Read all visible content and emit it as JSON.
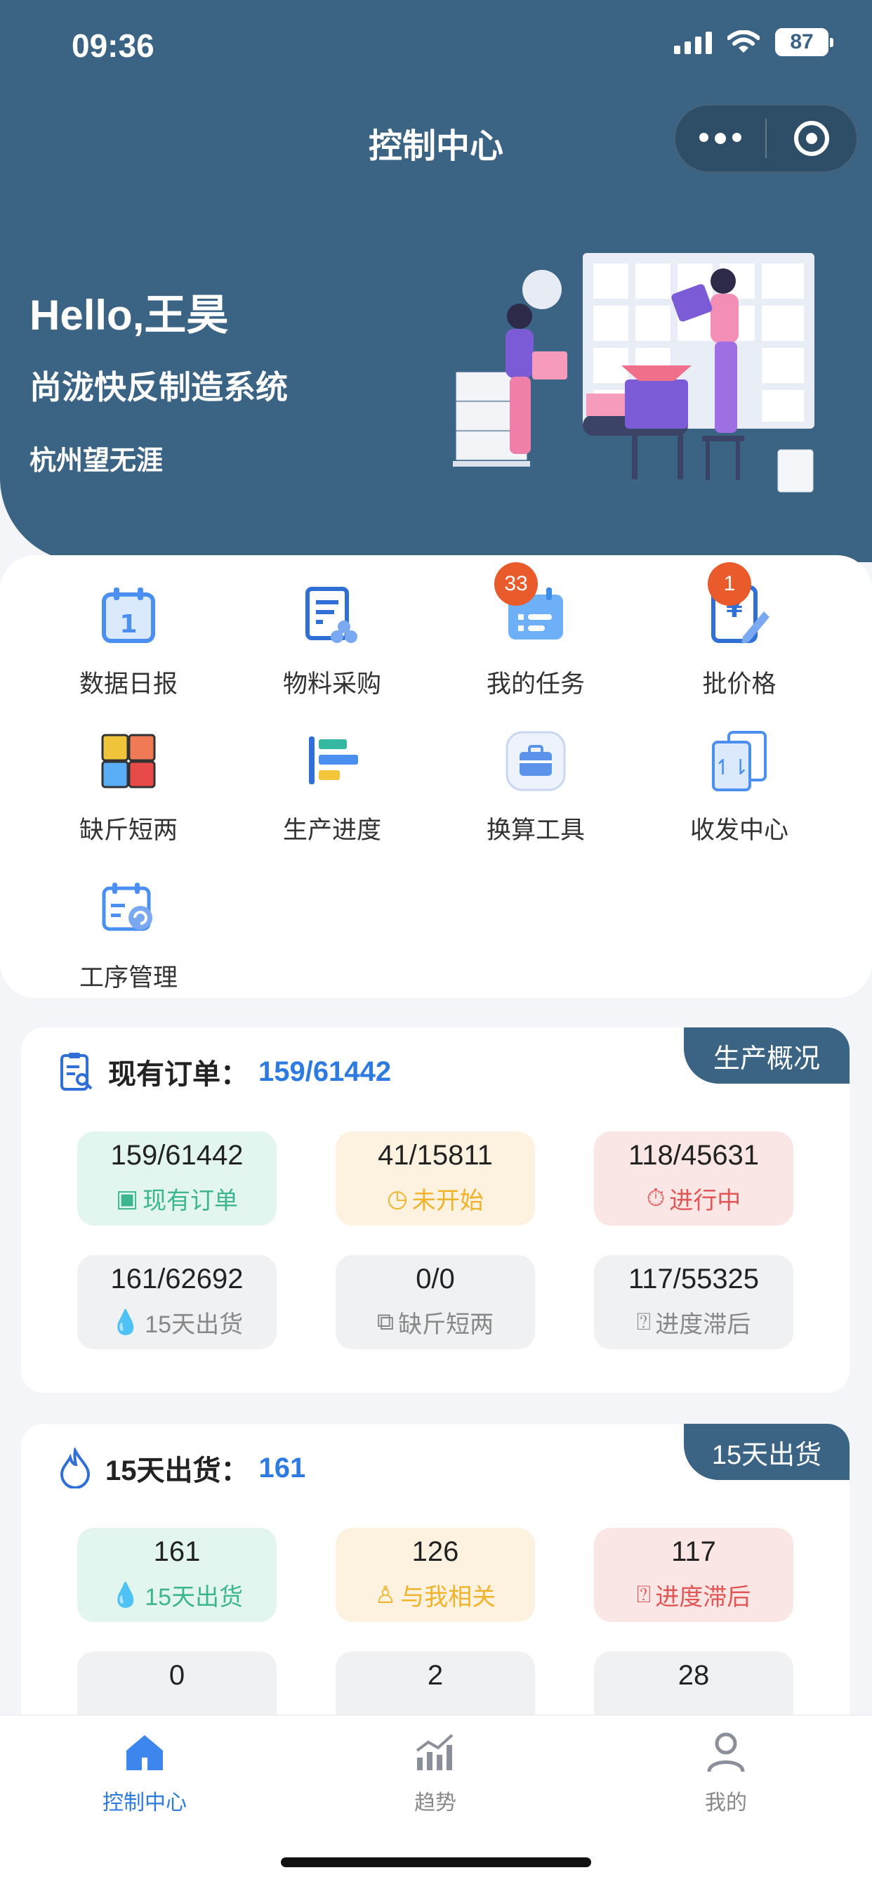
{
  "status_bar": {
    "time": "09:36",
    "battery": "87"
  },
  "nav": {
    "title": "控制中心"
  },
  "hero": {
    "greeting": "Hello,王昊",
    "system_name": "尚泷快反制造系统",
    "company": "杭州望无涯"
  },
  "menu": {
    "items": [
      {
        "label": "数据日报",
        "icon": "calendar-icon"
      },
      {
        "label": "物料采购",
        "icon": "document-list-icon"
      },
      {
        "label": "我的任务",
        "icon": "task-calendar-icon",
        "badge": "33"
      },
      {
        "label": "批价格",
        "icon": "price-edit-icon",
        "badge": "1"
      },
      {
        "label": "缺斤短两",
        "icon": "puzzle-icon"
      },
      {
        "label": "生产进度",
        "icon": "progress-bars-icon"
      },
      {
        "label": "换算工具",
        "icon": "toolbox-icon"
      },
      {
        "label": "收发中心",
        "icon": "transfer-icon"
      },
      {
        "label": "工序管理",
        "icon": "process-calendar-icon"
      }
    ]
  },
  "orders_card": {
    "ribbon": "生产概况",
    "title": "现有订单：",
    "value": "159/61442",
    "tiles": [
      {
        "num": "159/61442",
        "label": "现有订单",
        "icon": "search-doc-icon"
      },
      {
        "num": "41/15811",
        "label": "未开始",
        "icon": "clock-icon"
      },
      {
        "num": "118/45631",
        "label": "进行中",
        "icon": "timer-icon"
      },
      {
        "num": "161/62692",
        "label": "15天出货",
        "icon": "drop-icon"
      },
      {
        "num": "0/0",
        "label": "缺斤短两",
        "icon": "puzzle-piece-icon"
      },
      {
        "num": "117/55325",
        "label": "进度滞后",
        "icon": "question-doc-icon"
      }
    ]
  },
  "shipping_card": {
    "ribbon": "15天出货",
    "title": "15天出货：",
    "value": "161",
    "tiles": [
      {
        "num": "161",
        "label": "15天出货",
        "icon": "drop-icon"
      },
      {
        "num": "126",
        "label": "与我相关",
        "icon": "user-star-icon"
      },
      {
        "num": "117",
        "label": "进度滞后",
        "icon": "question-doc-icon"
      },
      {
        "num": "0"
      },
      {
        "num": "2"
      },
      {
        "num": "28"
      }
    ]
  },
  "tabbar": {
    "items": [
      {
        "label": "控制中心",
        "icon": "home-icon"
      },
      {
        "label": "趋势",
        "icon": "trend-icon"
      },
      {
        "label": "我的",
        "icon": "user-icon"
      }
    ]
  }
}
